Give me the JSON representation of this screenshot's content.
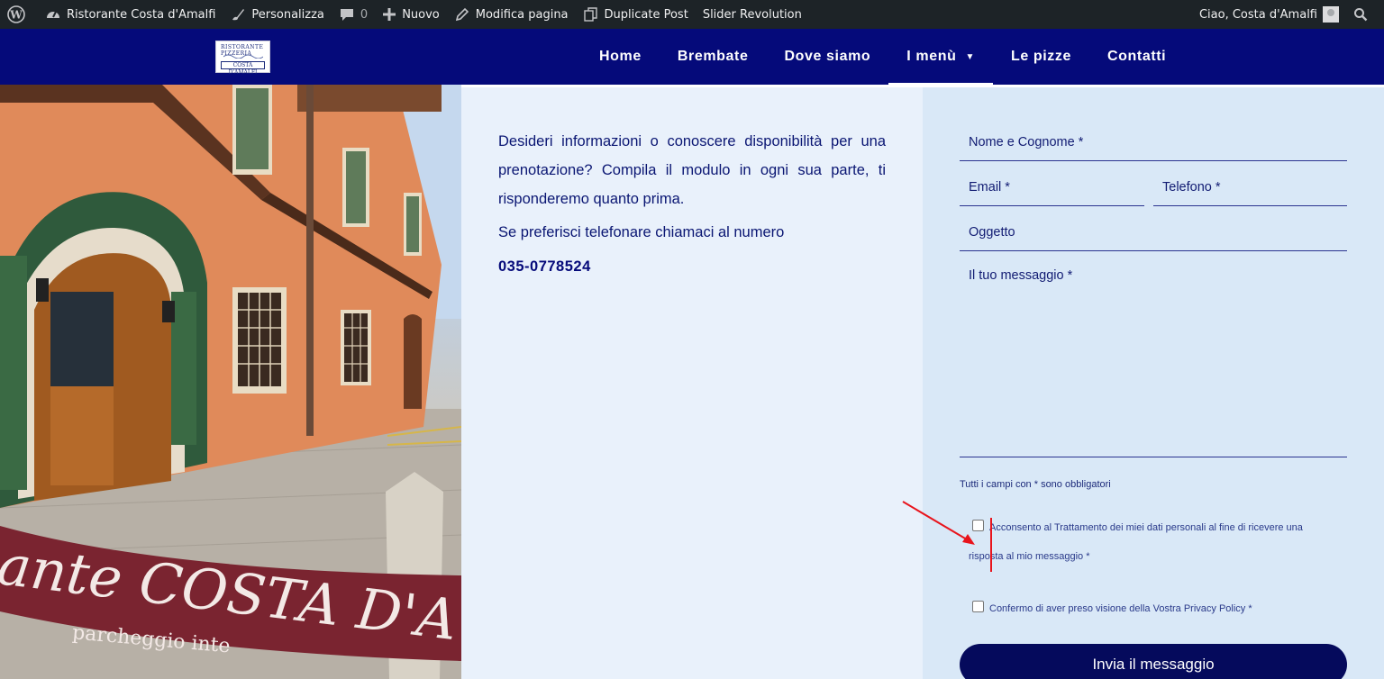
{
  "admin_bar": {
    "site_name": "Ristorante Costa d'Amalfi",
    "customize": "Personalizza",
    "comments_count": "0",
    "new": "Nuovo",
    "edit_page": "Modifica pagina",
    "duplicate_post": "Duplicate Post",
    "slider_revolution": "Slider Revolution",
    "greeting": "Ciao, Costa d'Amalfi"
  },
  "header": {
    "logo_line1": "RISTORANTE PIZZERIA",
    "logo_line2": "COSTA D'AMALFI",
    "nav": [
      {
        "label": "Home"
      },
      {
        "label": "Brembate"
      },
      {
        "label": "Dove siamo"
      },
      {
        "label": "I menù",
        "has_dropdown": true,
        "active": true
      },
      {
        "label": "Le pizze"
      },
      {
        "label": "Contatti"
      }
    ]
  },
  "photo": {
    "banner_text": "ante COSTA D'A",
    "banner_subtext": "parcheggio inte"
  },
  "info": {
    "intro": "Desideri informazioni o conoscere disponibilità per una prenotazione? Compila il modulo in ogni sua parte, ti risponderemo quanto prima.",
    "phone_lead": "Se preferisci telefonare chiamaci al numero",
    "phone": "035-0778524"
  },
  "form": {
    "name_label": "Nome e Cognome *",
    "email_label": "Email *",
    "phone_label": "Telefono *",
    "subject_label": "Oggetto",
    "message_label": "Il tuo messaggio *",
    "required_note": "Tutti i campi con * sono obbligatori",
    "consent_line1": "Acconsento al Trattamento dei miei dati personali al fine di ricevere una",
    "consent_line2": "risposta al mio messaggio *",
    "privacy_text": "Confermo di aver preso visione della Vostra Privacy Policy *",
    "submit_label": "Invia il messaggio"
  },
  "colors": {
    "header_bg": "#050a7a",
    "admin_bg": "#1d2327",
    "info_bg": "#e9f1fb",
    "form_bg": "#d9e8f7",
    "submit_bg": "#050a5c",
    "annotation": "#e8141c"
  }
}
